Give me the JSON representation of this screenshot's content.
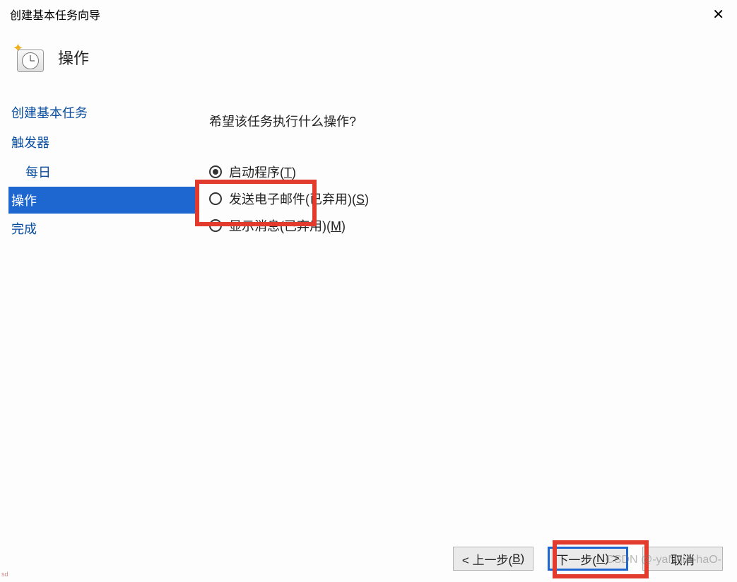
{
  "titlebar": {
    "title": "创建基本任务向导"
  },
  "header": {
    "title": "操作"
  },
  "sidebar": {
    "items": [
      {
        "label": "创建基本任务",
        "indent": false,
        "selected": false
      },
      {
        "label": "触发器",
        "indent": false,
        "selected": false
      },
      {
        "label": "每日",
        "indent": true,
        "selected": false
      },
      {
        "label": "操作",
        "indent": false,
        "selected": true
      },
      {
        "label": "完成",
        "indent": false,
        "selected": false
      }
    ]
  },
  "content": {
    "prompt": "希望该任务执行什么操作?",
    "options": [
      {
        "label_pre": "启动程序(",
        "key": "T",
        "label_post": ")",
        "checked": true
      },
      {
        "label_pre": "发送电子邮件(已弃用)(",
        "key": "S",
        "label_post": ")",
        "checked": false
      },
      {
        "label_pre": "显示消息(已弃用)(",
        "key": "M",
        "label_post": ")",
        "checked": false
      }
    ]
  },
  "footer": {
    "back_pre": "< 上一步(",
    "back_key": "B",
    "back_post": ")",
    "next_pre": "下一步(",
    "next_key": "N",
    "next_post": ") >",
    "cancel": "取消"
  },
  "watermark": "CSDN @-yaN-jiA-haO-",
  "tinymark": "sd"
}
